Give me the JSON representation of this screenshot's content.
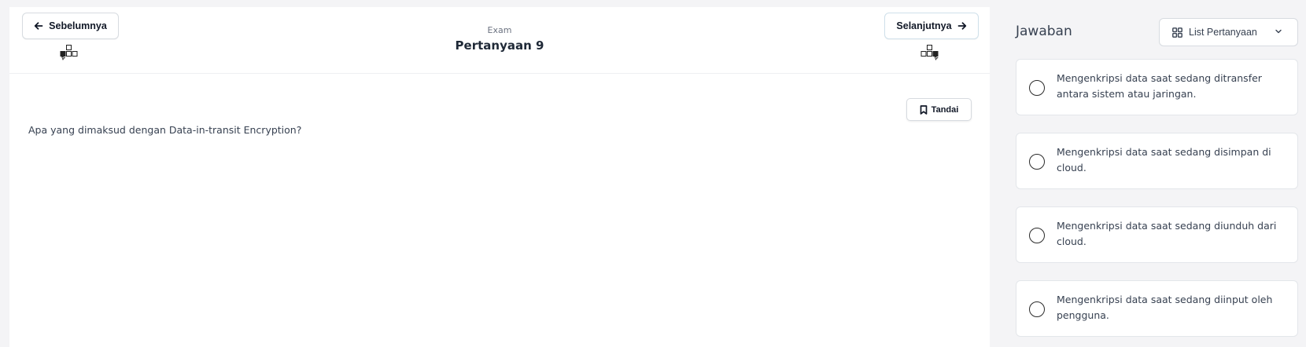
{
  "nav": {
    "prev_label": "Sebelumnya",
    "next_label": "Selanjutnya",
    "prev_icon": "arrow-left-icon",
    "next_icon": "arrow-right-icon",
    "keyboard_icon": "arrow-keys-icon"
  },
  "exam": {
    "subtitle": "Exam",
    "title": "Pertanyaan 9",
    "mark_label": "Tandai",
    "mark_icon": "bookmark-icon",
    "question": "Apa yang dimaksud dengan Data-in-transit Encryption?"
  },
  "sidebar": {
    "title": "Jawaban",
    "list_label": "List Pertanyaan",
    "list_icon": "grid-icon",
    "chevron_icon": "chevron-down-icon",
    "answers": [
      {
        "text": "Mengenkripsi data saat sedang ditransfer antara sistem atau jaringan."
      },
      {
        "text": "Mengenkripsi data saat sedang disimpan di cloud."
      },
      {
        "text": "Mengenkripsi data saat sedang diunduh dari cloud."
      },
      {
        "text": "Mengenkripsi data saat sedang diinput oleh pengguna."
      }
    ]
  },
  "colors": {
    "background": "#f4f4f6",
    "panel": "#ffffff",
    "border": "#d7dbe0",
    "text": "#1f2937"
  }
}
